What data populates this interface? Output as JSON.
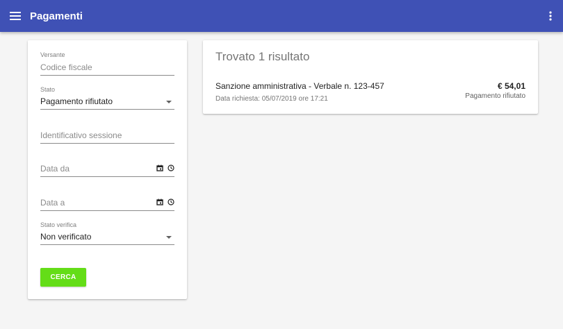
{
  "header": {
    "title": "Pagamenti",
    "background_color": "#3f51b5",
    "menu_icon": "menu-icon",
    "more_icon": "more-vert-icon"
  },
  "filters": {
    "versante": {
      "label": "Versante",
      "placeholder": "Codice fiscale",
      "value": ""
    },
    "stato": {
      "label": "Stato",
      "value": "Pagamento rifiutato"
    },
    "identificativo_sessione": {
      "placeholder": "Identificativo sessione",
      "value": ""
    },
    "data_da": {
      "placeholder": "Data da",
      "icons": [
        "calendar-icon",
        "clock-icon"
      ]
    },
    "data_a": {
      "placeholder": "Data a",
      "icons": [
        "calendar-icon",
        "clock-icon"
      ]
    },
    "stato_verifica": {
      "label": "Stato verifica",
      "value": "Non verificato"
    },
    "search_button_label": "CERCA",
    "search_button_color": "#64dd17"
  },
  "results": {
    "heading": "Trovato 1 risultato",
    "items": [
      {
        "title": "Sanzione amministrativa - Verbale n. 123-457",
        "date": "Data richiesta: 05/07/2019 ore 17:21",
        "amount": "€ 54,01",
        "status": "Pagamento rifiutato"
      }
    ]
  }
}
